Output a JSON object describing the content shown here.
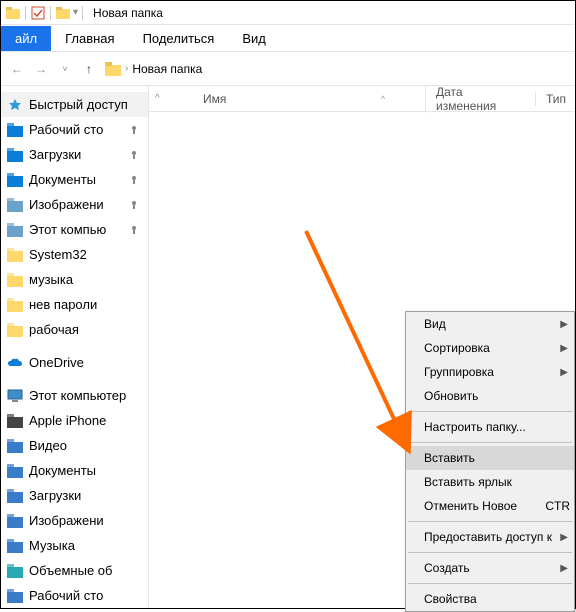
{
  "title": "Новая папка",
  "ribbon": {
    "file": "айл",
    "home": "Главная",
    "share": "Поделиться",
    "view": "Вид"
  },
  "address": {
    "folder": "Новая папка"
  },
  "columns": {
    "name": "Имя",
    "date": "Дата изменения",
    "type": "Тип"
  },
  "sidebar": {
    "quick": "Быстрый доступ",
    "items": [
      {
        "label": "Рабочий сто",
        "pin": true,
        "icon": "#0a7dd6"
      },
      {
        "label": "Загрузки",
        "pin": true,
        "icon": "#0a7dd6"
      },
      {
        "label": "Документы",
        "pin": true,
        "icon": "#0a7dd6"
      },
      {
        "label": "Изображени",
        "pin": true,
        "icon": "#6aa2cc"
      },
      {
        "label": "Этот компью",
        "pin": true,
        "icon": "#6aa2cc"
      },
      {
        "label": "System32",
        "pin": false,
        "icon": "#ffd86b"
      },
      {
        "label": "музыка",
        "pin": false,
        "icon": "#ffd86b"
      },
      {
        "label": "нев пароли",
        "pin": false,
        "icon": "#ffd86b"
      },
      {
        "label": "рабочая",
        "pin": false,
        "icon": "#ffd86b"
      }
    ],
    "onedrive": "OneDrive",
    "this_pc": "Этот компьютер",
    "pc_items": [
      {
        "label": "Apple iPhone",
        "icon": "#444"
      },
      {
        "label": "Видео",
        "icon": "#3a7cc9"
      },
      {
        "label": "Документы",
        "icon": "#3a7cc9"
      },
      {
        "label": "Загрузки",
        "icon": "#3a7cc9"
      },
      {
        "label": "Изображени",
        "icon": "#3a7cc9"
      },
      {
        "label": "Музыка",
        "icon": "#3a7cc9"
      },
      {
        "label": "Объемные об",
        "icon": "#2aa8b0"
      },
      {
        "label": "Рабочий сто",
        "icon": "#3a7cc9"
      }
    ]
  },
  "ctx": {
    "view": "Вид",
    "sort": "Сортировка",
    "group": "Группировка",
    "refresh": "Обновить",
    "customize": "Настроить папку...",
    "paste": "Вставить",
    "paste_shortcut": "Вставить ярлык",
    "undo": "Отменить Новое",
    "undo_key": "CTR",
    "grant": "Предоставить доступ к",
    "new": "Создать",
    "props": "Свойства"
  }
}
